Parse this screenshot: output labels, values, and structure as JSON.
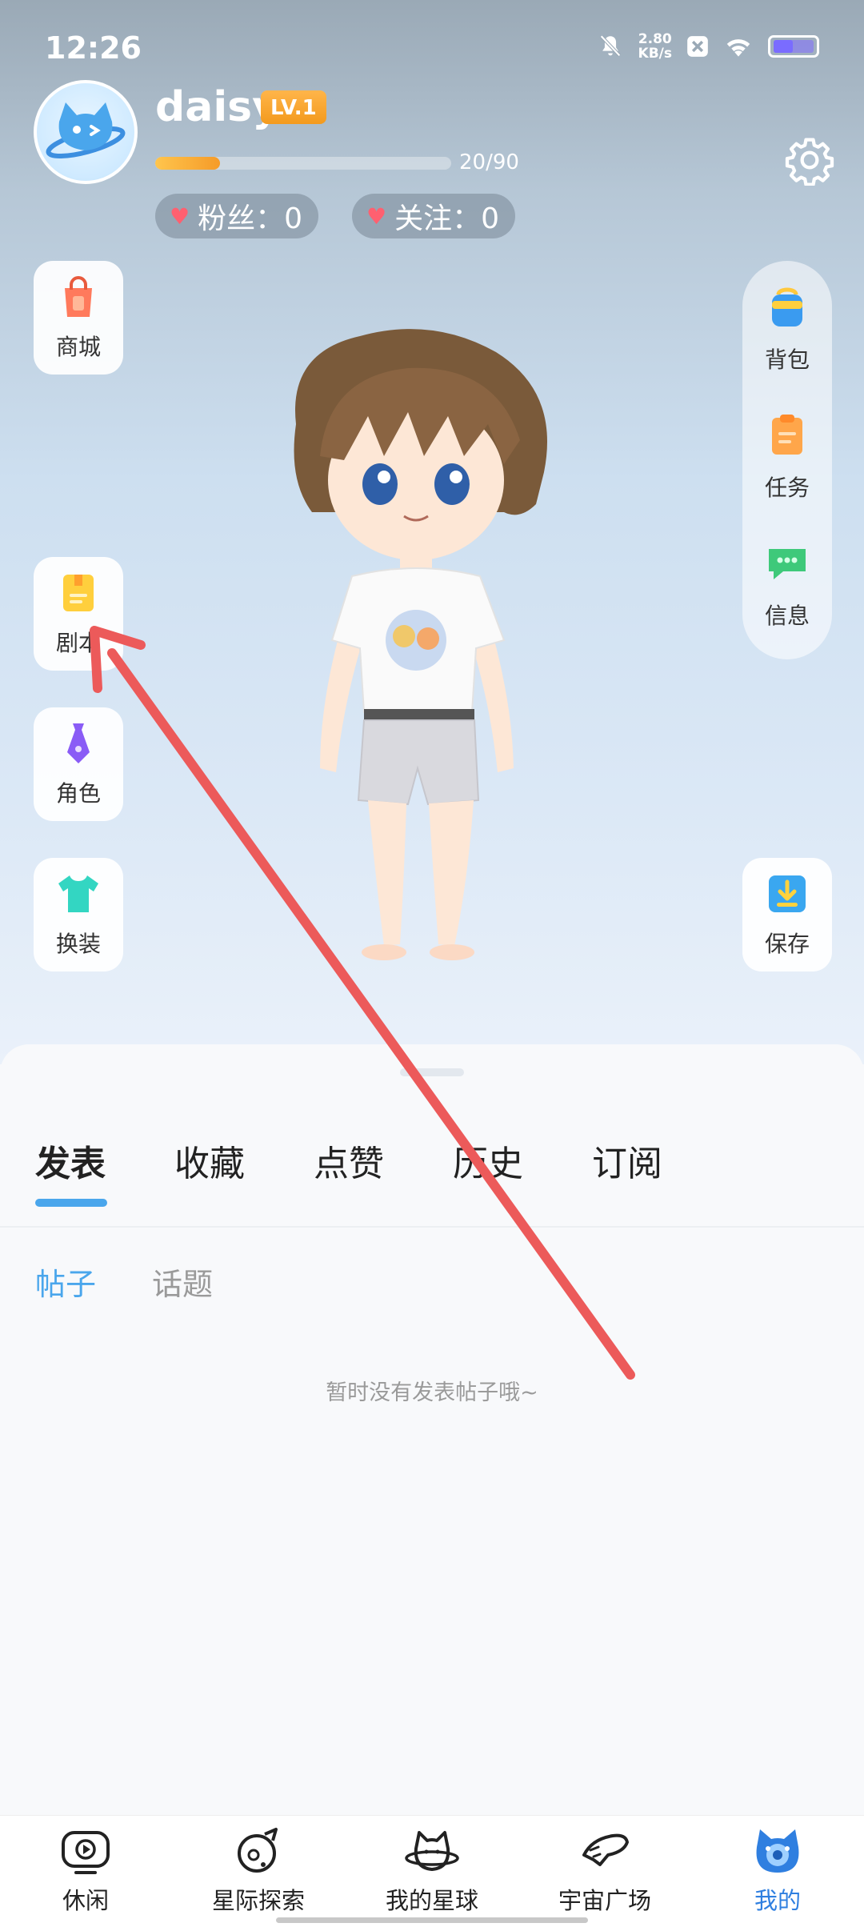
{
  "status_bar": {
    "time": "12:26",
    "net_speed_value": "2.80",
    "net_speed_unit": "KB/s"
  },
  "profile": {
    "username": "daisy",
    "level": "LV.1",
    "xp_text": "20/90",
    "xp_progress": 0.22,
    "fans_label": "粉丝：0",
    "follow_label": "关注：0"
  },
  "left_buttons": {
    "shop": "商城",
    "script": "剧本",
    "role": "角色",
    "dressup": "换装"
  },
  "right_buttons": {
    "backpack": "背包",
    "tasks": "任务",
    "messages": "信息",
    "save": "保存"
  },
  "tabs": [
    "发表",
    "收藏",
    "点赞",
    "历史",
    "订阅"
  ],
  "subtabs": [
    "帖子",
    "话题"
  ],
  "empty_message": "暂时没有发表帖子哦~",
  "bottom_nav": [
    "休闲",
    "星际探索",
    "我的星球",
    "宇宙广场",
    "我的"
  ],
  "colors": {
    "accent_blue": "#4aa6ec",
    "nav_active": "#2f7fe0",
    "annotation_arrow": "#ec5a5a",
    "level_badge": "#f5a028"
  }
}
